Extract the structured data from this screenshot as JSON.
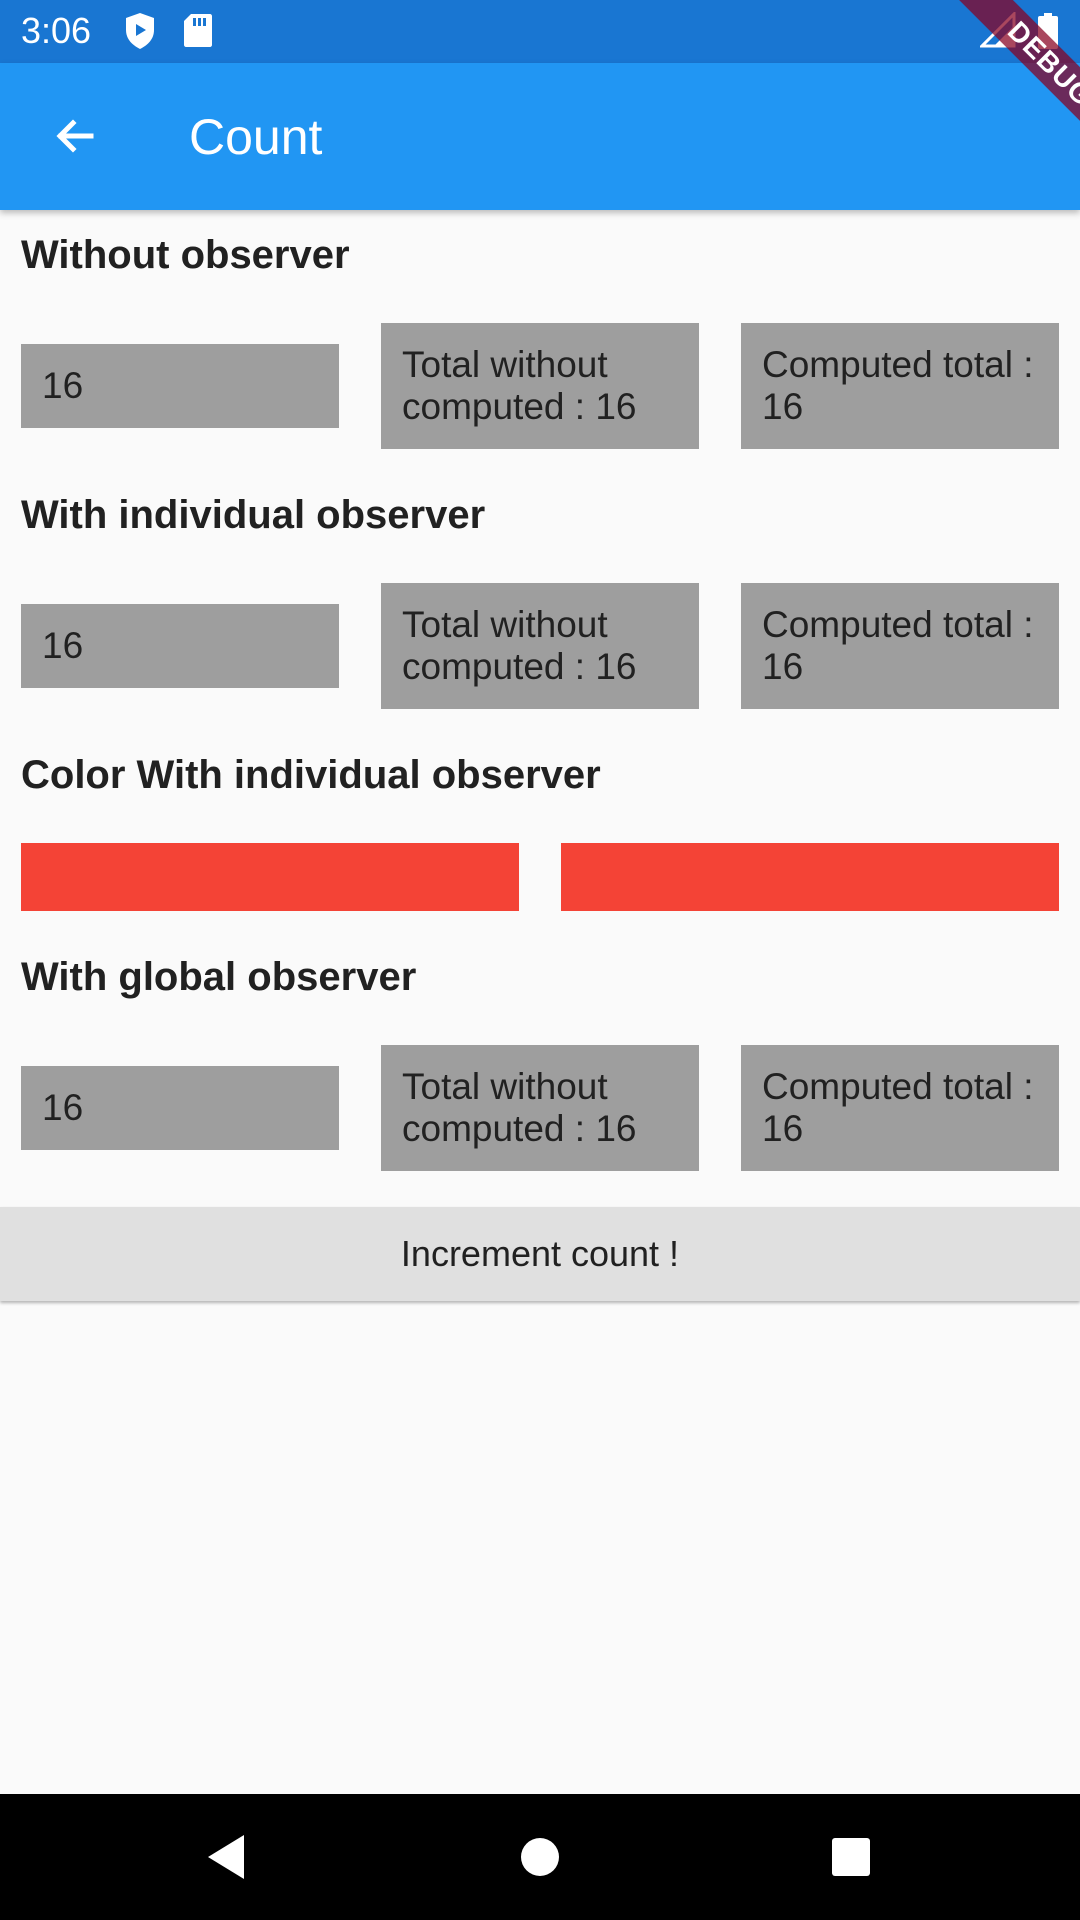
{
  "status_bar": {
    "time": "3:06",
    "icons": [
      "shield-icon",
      "sd-card-icon",
      "signal-icon",
      "battery-icon"
    ],
    "background": "#1976D2"
  },
  "app_bar": {
    "title": "Count",
    "back_icon": "arrow-back-icon",
    "background": "#2196F3"
  },
  "debug_banner": "DEBUG",
  "sections": {
    "without_observer": {
      "title": "Without observer",
      "value": "16",
      "total_without_computed": "Total without computed : 16",
      "computed_total": "Computed total : 16"
    },
    "individual_observer": {
      "title": "With individual observer",
      "value": "16",
      "total_without_computed": "Total without computed : 16",
      "computed_total": "Computed total : 16"
    },
    "color_individual": {
      "title": "Color With individual observer",
      "color": "#F44336"
    },
    "global_observer": {
      "title": "With global observer",
      "value": "16",
      "total_without_computed": "Total without computed : 16",
      "computed_total": "Computed total : 16"
    }
  },
  "increment_button": {
    "label": "Increment count !"
  },
  "nav_bar": {
    "icons": [
      "back-triangle-icon",
      "home-circle-icon",
      "recents-square-icon"
    ]
  }
}
